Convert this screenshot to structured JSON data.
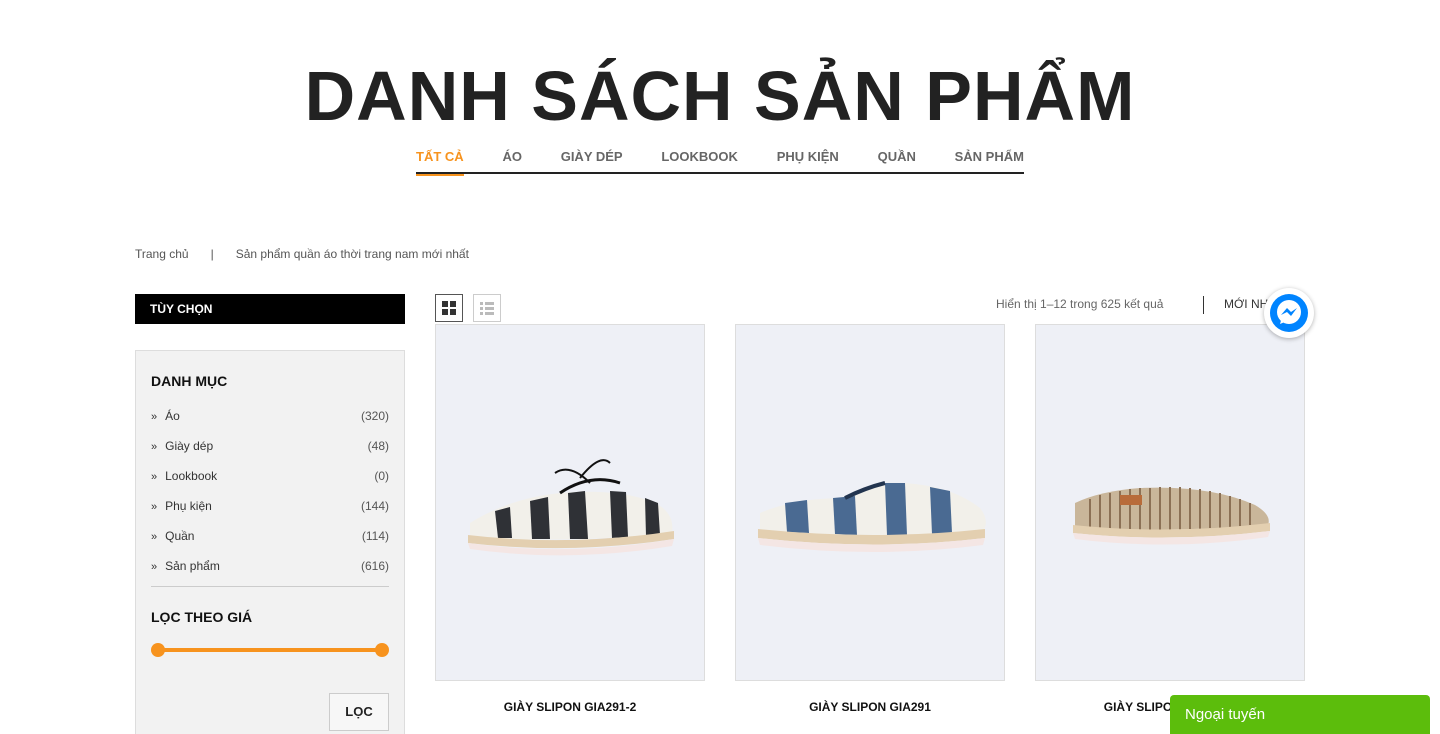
{
  "page": {
    "title": "DANH SÁCH SẢN PHẨM"
  },
  "category_tabs": [
    {
      "label": "TẤT CẢ",
      "active": true
    },
    {
      "label": "ÁO",
      "active": false
    },
    {
      "label": "GIÀY DÉP",
      "active": false
    },
    {
      "label": "LOOKBOOK",
      "active": false
    },
    {
      "label": "PHỤ KIỆN",
      "active": false
    },
    {
      "label": "QUẦN",
      "active": false
    },
    {
      "label": "SẢN PHẨM",
      "active": false
    }
  ],
  "breadcrumb": {
    "home": "Trang chủ",
    "separator": "|",
    "current": "Sản phẩm quần áo thời trang nam mới nhất"
  },
  "sidebar": {
    "header": "TÙY CHỌN",
    "categories_title": "DANH MỤC",
    "categories": [
      {
        "name": "Áo",
        "count": "(320)"
      },
      {
        "name": "Giày dép",
        "count": "(48)"
      },
      {
        "name": "Lookbook",
        "count": "(0)"
      },
      {
        "name": "Phụ kiện",
        "count": "(144)"
      },
      {
        "name": "Quần",
        "count": "(114)"
      },
      {
        "name": "Sản phẩm",
        "count": "(616)"
      }
    ],
    "price_filter_title": "LỌC THEO GIÁ",
    "price_range_fraction": [
      0,
      1
    ],
    "filter_button": "LỌC"
  },
  "toolbar": {
    "result_count": "Hiển thị 1–12 trong 625 kết quả",
    "sort_label": "MỚI NHẤT",
    "view_modes": [
      "grid",
      "list"
    ],
    "active_view": "grid"
  },
  "products": [
    {
      "name": "GIÀY SLIPON GIA291-2",
      "shoe_style": "lace-up",
      "stripe_color": "#2f3136",
      "base_color": "#f2f0ea"
    },
    {
      "name": "GIÀY SLIPON GIA291",
      "shoe_style": "slip-on",
      "stripe_color": "#4a6a92",
      "base_color": "#f2f0ea"
    },
    {
      "name": "GIÀY SLIPON GIA291-1",
      "shoe_style": "slip-on",
      "stripe_color": "#8b7055",
      "base_color": "#c9b69a"
    }
  ],
  "chat": {
    "status": "Ngoại tuyến"
  },
  "colors": {
    "accent": "#f7931e",
    "chat_green": "#5cbd0c",
    "messenger_blue": "#0084ff"
  },
  "icons": {
    "grid_view": "grid-view-icon",
    "list_view": "list-view-icon",
    "messenger": "messenger-icon",
    "category_bullet": "double-chevron-right-icon"
  }
}
